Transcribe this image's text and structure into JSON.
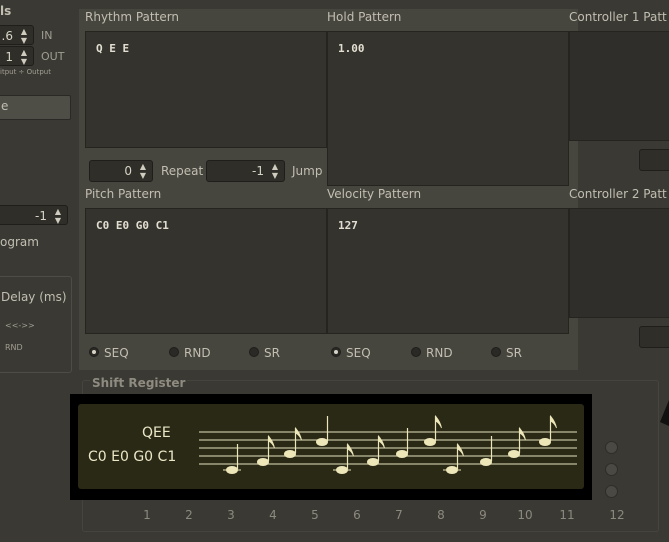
{
  "left_panel": {
    "title_fragment": "ls",
    "in_spin": {
      "value": ".6",
      "label": "IN"
    },
    "out_spin": {
      "value": "1",
      "label": "OUT"
    },
    "io_caption": "itput ÷ Output",
    "button_label": "e",
    "program_spin_value": "-1",
    "program_label": "ogram",
    "delay_label": "Delay (ms)",
    "arrow_label": "<<->>",
    "rnd_label": "RND"
  },
  "rhythm": {
    "title": "Rhythm Pattern",
    "text": "Q E E"
  },
  "hold": {
    "title": "Hold Pattern",
    "text": "1.00"
  },
  "controller1": {
    "title": "Controller 1 Patt"
  },
  "controller2": {
    "title": "Controller 2 Patt"
  },
  "repeat": {
    "value": "0",
    "label": "Repeat"
  },
  "jump": {
    "value": "-1",
    "label": "Jump"
  },
  "pitch": {
    "title": "Pitch Pattern",
    "text": "C0 E0 G0 C1"
  },
  "velocity": {
    "title": "Velocity Pattern",
    "text": "127"
  },
  "pitch_modes": {
    "seq": "SEQ",
    "rnd": "RND",
    "sr": "SR",
    "selected": "SEQ"
  },
  "velocity_modes": {
    "seq": "SEQ",
    "rnd": "RND",
    "sr": "SR",
    "selected": "SEQ"
  },
  "shift_register": {
    "title": "Shift Register",
    "numbers": [
      "1",
      "2",
      "3",
      "4",
      "5",
      "6",
      "7",
      "8",
      "9",
      "10",
      "11",
      "12"
    ]
  },
  "tooltip": {
    "rhythm_line": "QEE",
    "pitch_line": "C0 E0 G0 C1"
  },
  "colors": {
    "background": "#3a3933",
    "panel": "#46453e",
    "editor": "#34332d",
    "tooltip_bg": "#2a2916",
    "note": "#ece6b8"
  }
}
